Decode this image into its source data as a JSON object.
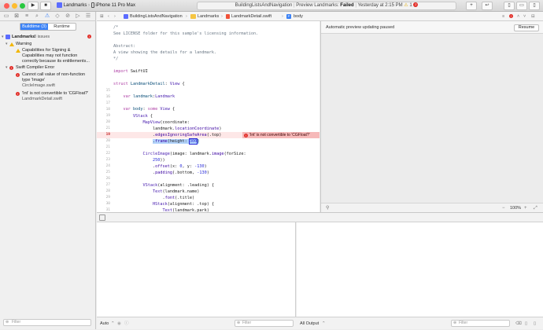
{
  "toolbar": {
    "scheme_target": "Landmarks",
    "scheme_device": "iPhone 11 Pro Max",
    "activity_project": "BuildingListsAndNavigation",
    "activity_status_prefix": "Preview Landmarks:",
    "activity_status": "Failed",
    "activity_time": "Yesterday at 2:15 PM",
    "warnings_count": "1",
    "errors_count": "2"
  },
  "navigator": {
    "tab_buildtime": "Buildtime (3)",
    "tab_runtime": "Runtime",
    "project_name": "Landmarks",
    "project_issues": "3 issues",
    "warning_group": "Warning",
    "warning_text_1": "Capabilities for Signing &",
    "warning_text_2": "Capabilities may not function",
    "warning_text_3": "correctly because its entitlements...",
    "error_group": "Swift Compiler Error",
    "error1_text_1": "Cannot call value of non-function",
    "error1_text_2": "type 'Image'",
    "error1_file": "CircleImage.swift",
    "error2_text": "'Int' is not convertible to 'CGFloat?'",
    "error2_file": "LandmarkDetail.swift",
    "filter_placeholder": "Filter"
  },
  "jumpbar": {
    "crumb1": "BuildingListsAndNavigation",
    "crumb2": "Landmarks",
    "crumb3": "LandmarkDetail.swift",
    "crumb4": "body"
  },
  "editor": {
    "error_message": "'Int' is not convertible to 'CGFloat?'"
  },
  "preview": {
    "message": "Automatic preview updating paused",
    "resume_label": "Resume",
    "zoom": "100%"
  },
  "debug": {
    "auto_label": "Auto",
    "filter_placeholder": "Filter",
    "output_label": "All Output"
  }
}
